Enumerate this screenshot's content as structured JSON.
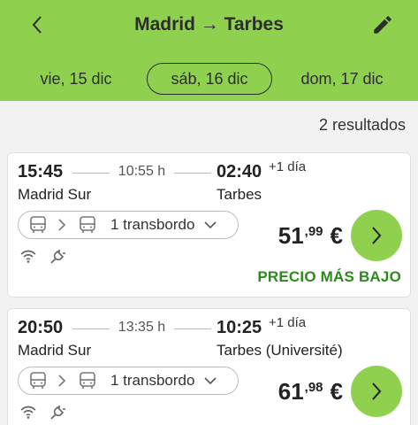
{
  "header": {
    "title": "Madrid → Tarbes",
    "accent_color": "#8fd14f",
    "back_icon": "chevron-left-icon",
    "edit_icon": "pencil-icon"
  },
  "dates": {
    "prev": "vie, 15 dic",
    "current": "sáb, 16 dic",
    "next": "dom, 17 dic"
  },
  "results_count": "2 resultados",
  "trips": [
    {
      "departure_time": "15:45",
      "duration": "10:55 h",
      "arrival_time": "02:40",
      "plus_day": "+1 día",
      "departure_station": "Madrid Sur",
      "arrival_station": "Tarbes",
      "transfers": "1 transbordo",
      "price_int": "51",
      "price_dec": ",99",
      "currency": "€",
      "badge": "PRECIO MÁS BAJO",
      "amenities": [
        "wifi-icon",
        "power-plug-icon"
      ]
    },
    {
      "departure_time": "20:50",
      "duration": "13:35 h",
      "arrival_time": "10:25",
      "plus_day": "+1 día",
      "departure_station": "Madrid Sur",
      "arrival_station": "Tarbes (Université)",
      "transfers": "1 transbordo",
      "price_int": "61",
      "price_dec": ",98",
      "currency": "€",
      "amenities": [
        "wifi-icon",
        "power-plug-icon"
      ]
    }
  ]
}
